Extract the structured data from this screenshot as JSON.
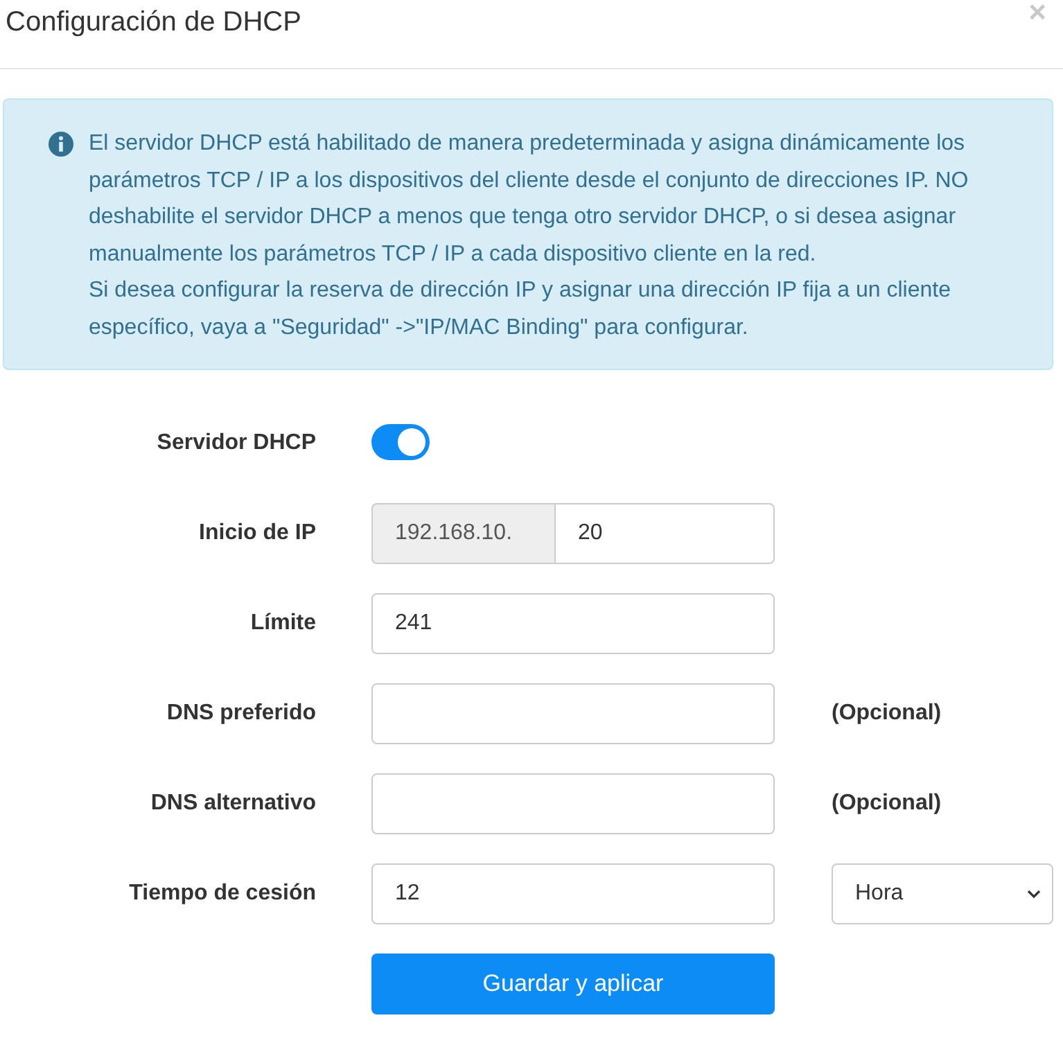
{
  "dialog": {
    "title": "Configuración de DHCP",
    "close": "×"
  },
  "info": {
    "paragraphs": [
      "El servidor DHCP está habilitado de manera predeterminada y asigna dinámicamente los parámetros TCP / IP a los dispositivos del cliente desde el conjunto de direcciones IP. NO deshabilite el servidor DHCP a menos que tenga otro servidor DHCP, o si desea asignar manualmente los parámetros TCP / IP a cada dispositivo cliente en la red.",
      "Si desea configurar la reserva de dirección IP y asignar una dirección IP fija a un cliente específico, vaya a \"Seguridad\" ->\"IP/MAC Binding\" para configurar."
    ]
  },
  "fields": [
    {
      "kind": "toggle",
      "label": "Servidor DHCP",
      "on": true
    },
    {
      "kind": "addon-input",
      "label": "Inicio de IP",
      "prefix": "192.168.10.",
      "value": "20"
    },
    {
      "kind": "input",
      "label": "Límite",
      "value": "241"
    },
    {
      "kind": "input",
      "label": "DNS preferido",
      "note": "(Opcional)"
    },
    {
      "kind": "input",
      "label": "DNS alternativo",
      "note": "(Opcional)"
    },
    {
      "kind": "input-select",
      "label": "Tiempo de cesión",
      "value": "12",
      "option": "Hora"
    }
  ],
  "submit": "Guardar y aplicar"
}
